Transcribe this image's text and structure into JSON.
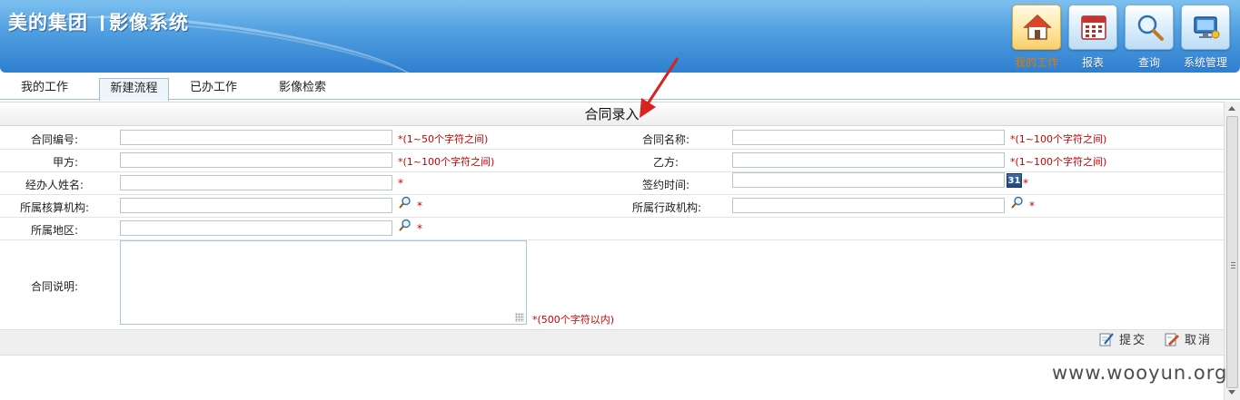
{
  "header": {
    "brand": "美的集团",
    "system": "影像系统",
    "nav": [
      {
        "label": "我的工作",
        "icon": "home-icon",
        "active": true
      },
      {
        "label": "报表",
        "icon": "report-calendar-icon",
        "active": false
      },
      {
        "label": "查询",
        "icon": "magnifier-icon",
        "active": false
      },
      {
        "label": "系统管理",
        "icon": "monitor-settings-icon",
        "active": false
      }
    ]
  },
  "tabs": [
    {
      "label": "我的工作",
      "active": false
    },
    {
      "label": "新建流程",
      "active": true
    },
    {
      "label": "已办工作",
      "active": false
    },
    {
      "label": "影像检索",
      "active": false
    }
  ],
  "form": {
    "title": "合同录入",
    "fields": {
      "contract_no": {
        "label": "合同编号:",
        "value": "",
        "hint": "*(1~50个字符之间)"
      },
      "contract_name": {
        "label": "合同名称:",
        "value": "",
        "hint": "*(1~100个字符之间)"
      },
      "party_a": {
        "label": "甲方:",
        "value": "",
        "hint": "*(1~100个字符之间)"
      },
      "party_b": {
        "label": "乙方:",
        "value": "",
        "hint": "*(1~100个字符之间)"
      },
      "handler_name": {
        "label": "经办人姓名:",
        "value": "",
        "hint": "*"
      },
      "sign_date": {
        "label": "签约时间:",
        "value": "",
        "hint": "*",
        "calendar_label": "31"
      },
      "accounting_org": {
        "label": "所属核算机构:",
        "value": "",
        "hint": "*"
      },
      "admin_org": {
        "label": "所属行政机构:",
        "value": "",
        "hint": "*"
      },
      "region": {
        "label": "所属地区:",
        "value": "",
        "hint": "*"
      },
      "description": {
        "label": "合同说明:",
        "value": "",
        "hint": "*(500个字符以内)"
      }
    },
    "actions": {
      "submit": "提交",
      "cancel": "取消"
    }
  },
  "watermark": "www.wooyun.org",
  "colors": {
    "header_blue": "#4f9ee0",
    "required_red": "#cc0000",
    "active_nav": "#e07a00"
  }
}
